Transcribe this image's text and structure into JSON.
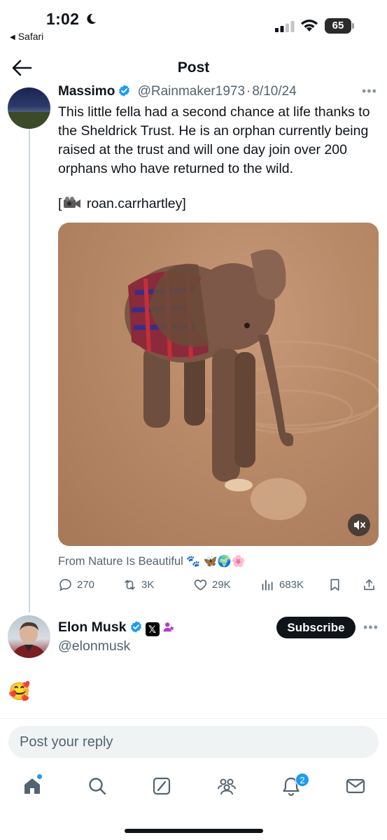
{
  "status_bar": {
    "time": "1:02",
    "back_app": "Safari",
    "battery": "65"
  },
  "nav": {
    "title": "Post"
  },
  "quoted_post": {
    "name": "Massimo",
    "handle": "@Rainmaker1973",
    "separator": "·",
    "date": "8/10/24",
    "text": "This little fella had a second chance at life thanks to the Sheldrick Trust. He is an orphan currently being raised at the trust and will one day join over 200 orphans who have returned to the wild.",
    "credit_open": "[",
    "credit_name": "roan.carrhartley]",
    "source": "From Nature Is Beautiful",
    "source_emoji": "🐾 🦋🌍🌸",
    "stats": {
      "replies": "270",
      "reposts": "3K",
      "likes": "29K",
      "views": "683K"
    }
  },
  "reply": {
    "name": "Elon Musk",
    "x_badge": "𝕏",
    "handle": "@elonmusk",
    "subscribe_label": "Subscribe",
    "text": "🥰"
  },
  "composer": {
    "placeholder": "Post your reply"
  },
  "tabbar": {
    "notifications_count": "2",
    "icons": [
      "home-icon",
      "search-icon",
      "grok-icon",
      "communities-icon",
      "notifications-icon",
      "messages-icon"
    ]
  },
  "colors": {
    "accent": "#1d9bf0",
    "text_primary": "#0f1419",
    "text_secondary": "#536471",
    "affiliate": "#b13ac9"
  }
}
